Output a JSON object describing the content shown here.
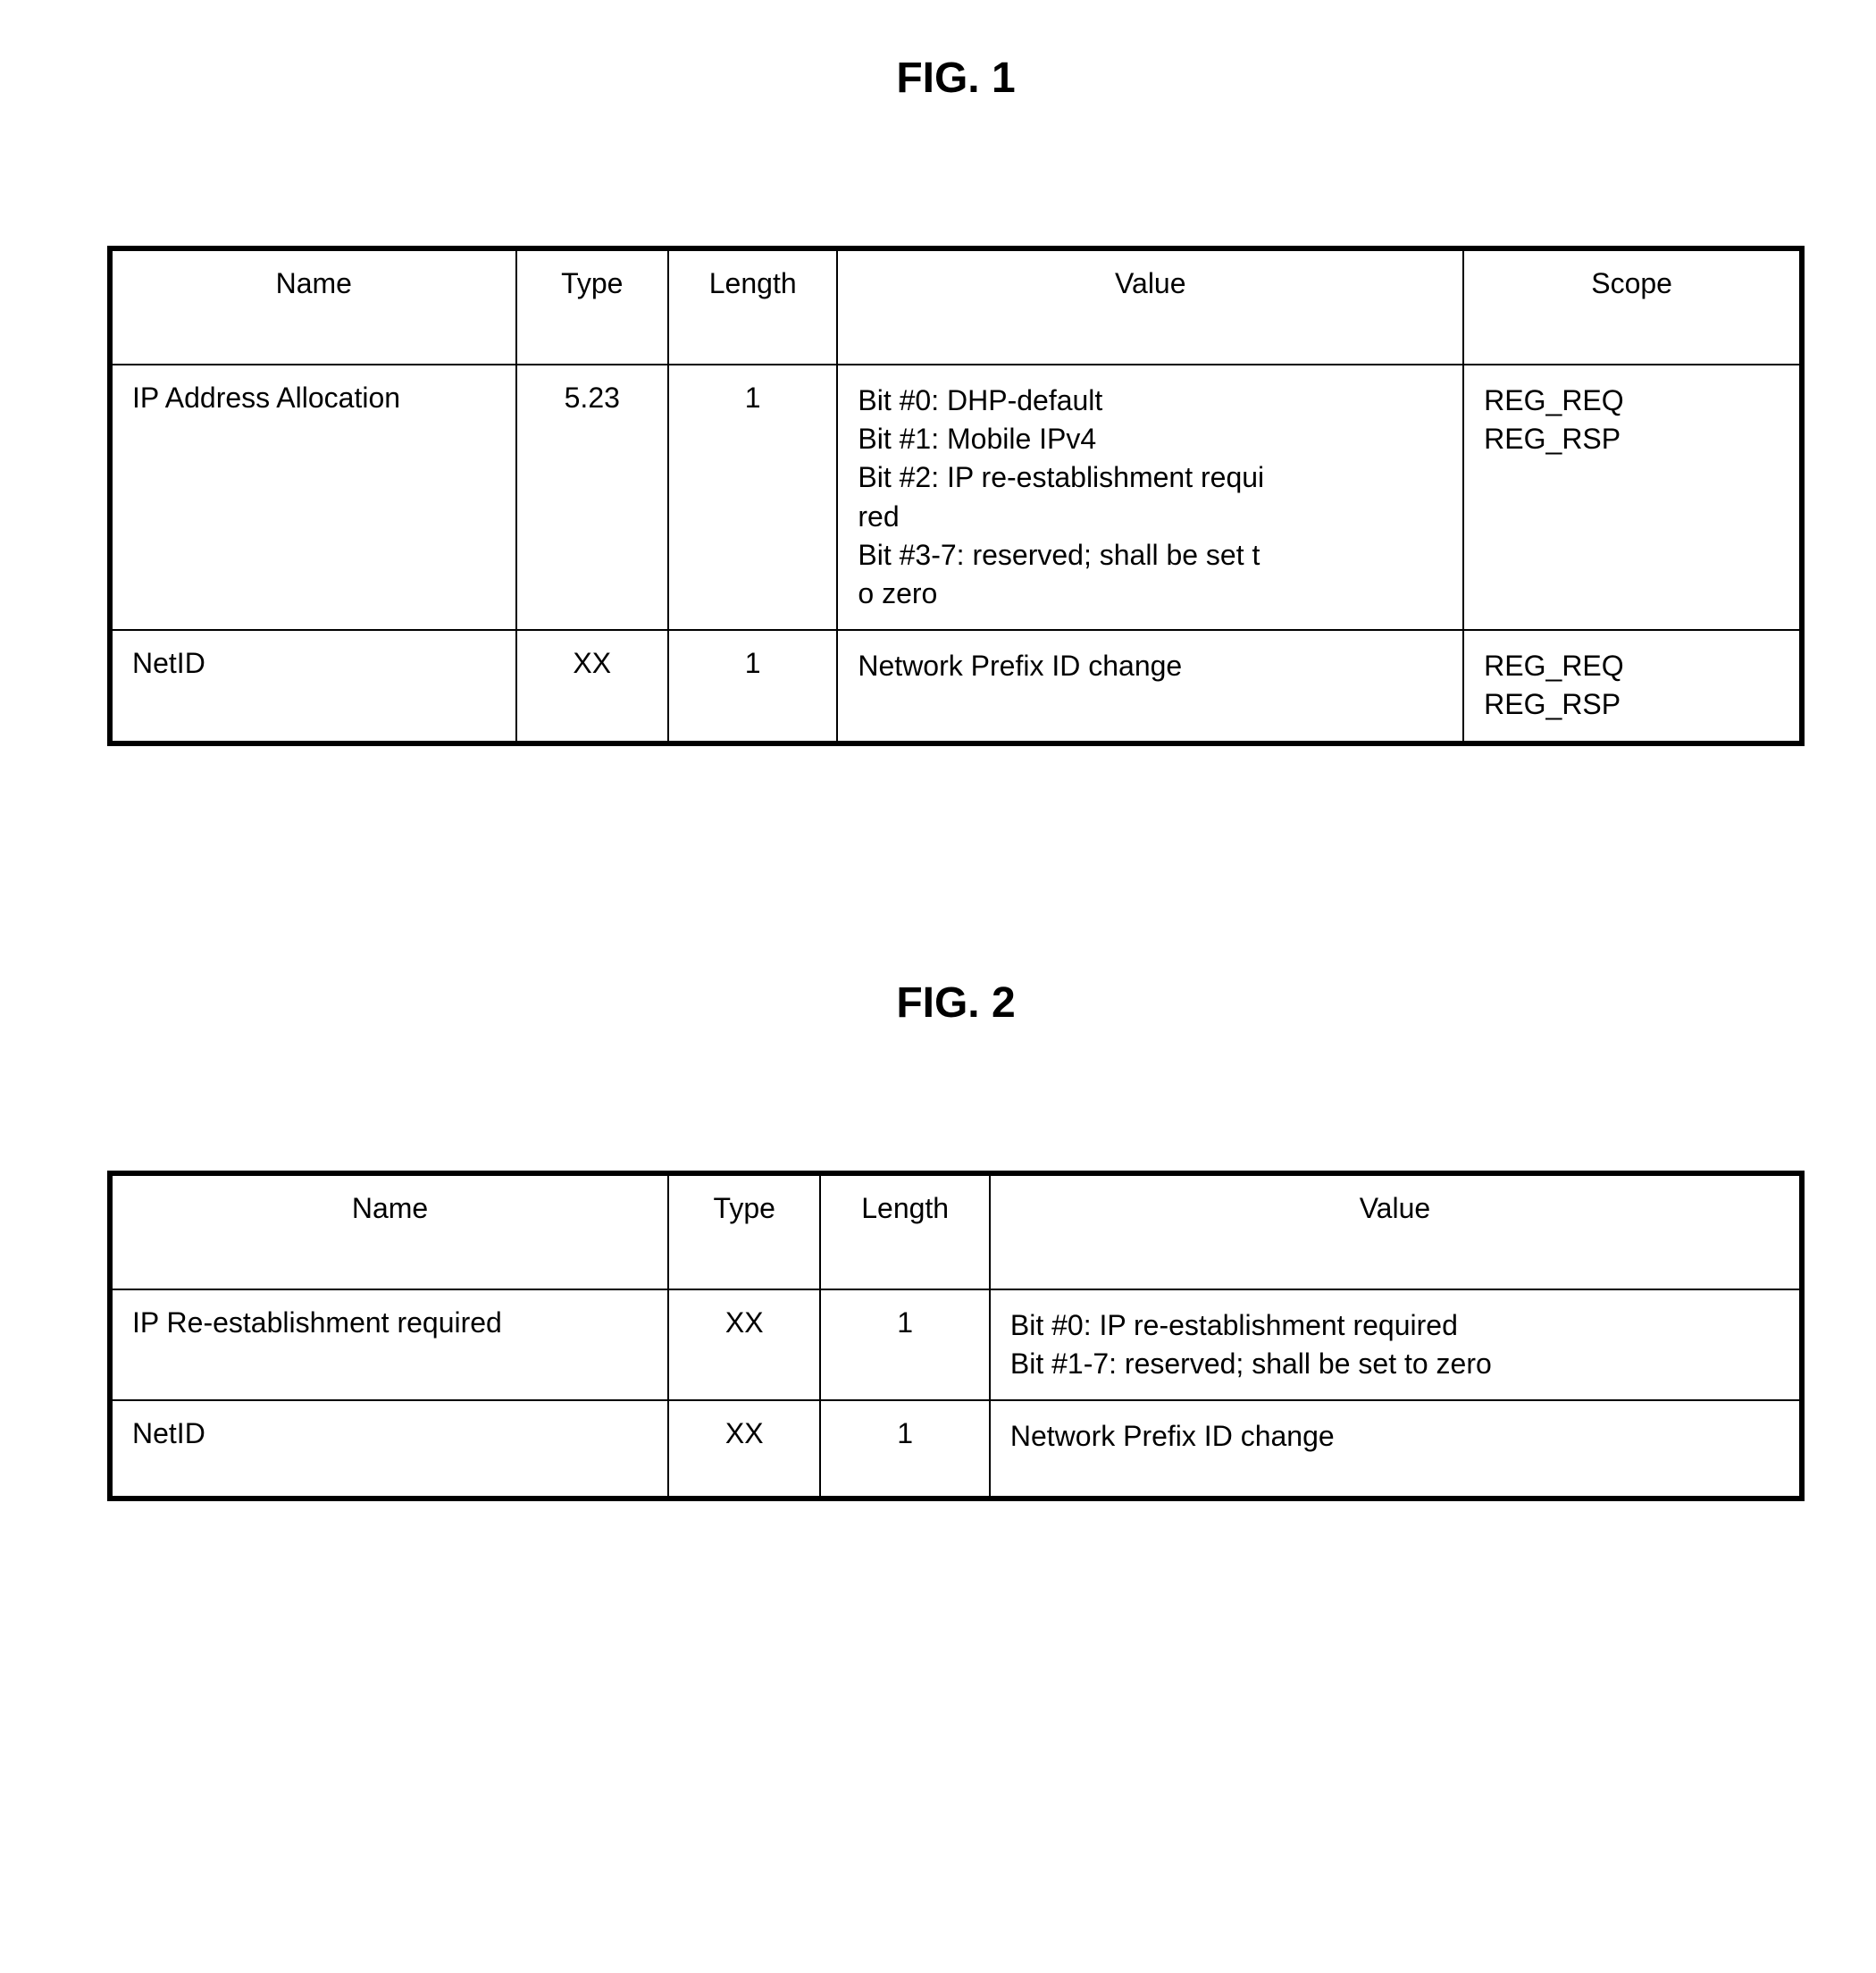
{
  "fig1": {
    "title": "FIG. 1",
    "headers": [
      "Name",
      "Type",
      "Length",
      "Value",
      "Scope"
    ],
    "rows": [
      {
        "name": "IP Address Allocation",
        "type": "5.23",
        "length": "1",
        "value": "Bit #0: DHP-default\nBit #1: Mobile IPv4\nBit #2: IP re-establishment requi\nred\nBit #3-7: reserved; shall be set t\no zero",
        "scope": "REG_REQ\nREG_RSP"
      },
      {
        "name": "NetID",
        "type": "XX",
        "length": "1",
        "value": "Network Prefix ID change",
        "scope": "REG_REQ\nREG_RSP"
      }
    ]
  },
  "fig2": {
    "title": "FIG. 2",
    "headers": [
      "Name",
      "Type",
      "Length",
      "Value"
    ],
    "rows": [
      {
        "name": "IP Re-establishment required",
        "type": "XX",
        "length": "1",
        "value": "Bit #0: IP re-establishment required\nBit #1-7: reserved; shall be set to zero"
      },
      {
        "name": "NetID",
        "type": "XX",
        "length": "1",
        "value": "Network Prefix ID change"
      }
    ]
  }
}
